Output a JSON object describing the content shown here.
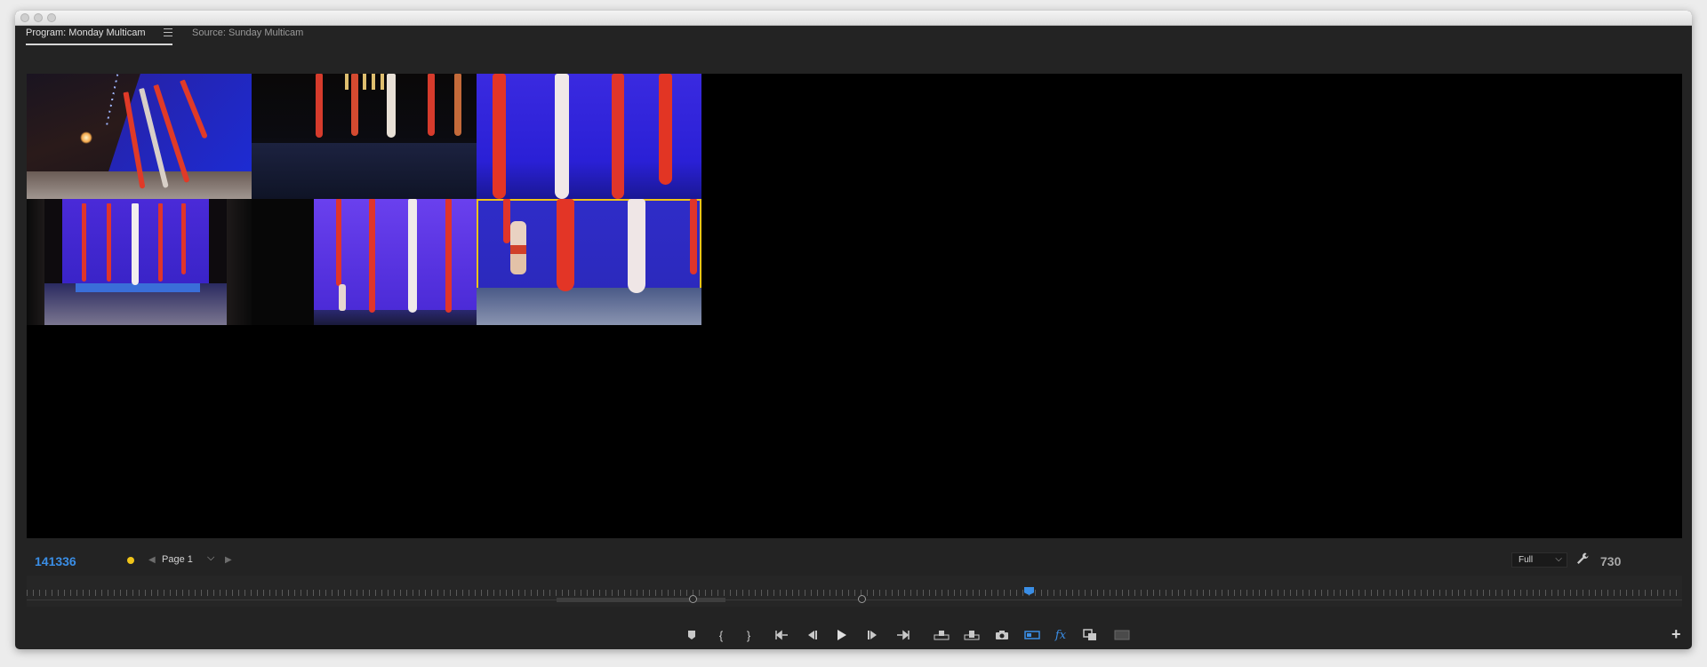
{
  "window": {
    "tabs": [
      {
        "label": "Program: Monday Multicam",
        "active": true
      },
      {
        "label": "Source: Sunday Multicam",
        "active": false
      }
    ]
  },
  "monitor": {
    "timecode": "141336",
    "page_label": "Page 1",
    "zoom_value": "Full",
    "frame_count": "730",
    "selected_camera": 6,
    "timecode_color": "#3a8ee6",
    "selection_color": "#f0c419"
  },
  "cameras": [
    {
      "id": 1,
      "scene": "side-angle-stage"
    },
    {
      "id": 2,
      "scene": "wide-dark-stage"
    },
    {
      "id": 3,
      "scene": "closeup-fabrics"
    },
    {
      "id": 4,
      "scene": "wide-blue-stage"
    },
    {
      "id": 5,
      "scene": "stage-left-dancer"
    },
    {
      "id": 6,
      "scene": "closeup-dancer"
    }
  ],
  "transport_icons": [
    "add-marker-icon",
    "mark-in-icon",
    "mark-out-icon",
    "go-to-in-icon",
    "step-back-icon",
    "play-icon",
    "step-forward-icon",
    "go-to-out-icon",
    "insert-icon",
    "overwrite-icon",
    "export-frame-icon",
    "multicam-icon",
    "fx-icon",
    "compare-icon",
    "safe-margins-icon"
  ],
  "icons": {
    "wrench": "wrench-icon",
    "add_button": "plus-icon"
  },
  "timeline": {
    "playhead_fraction": 0.606
  }
}
